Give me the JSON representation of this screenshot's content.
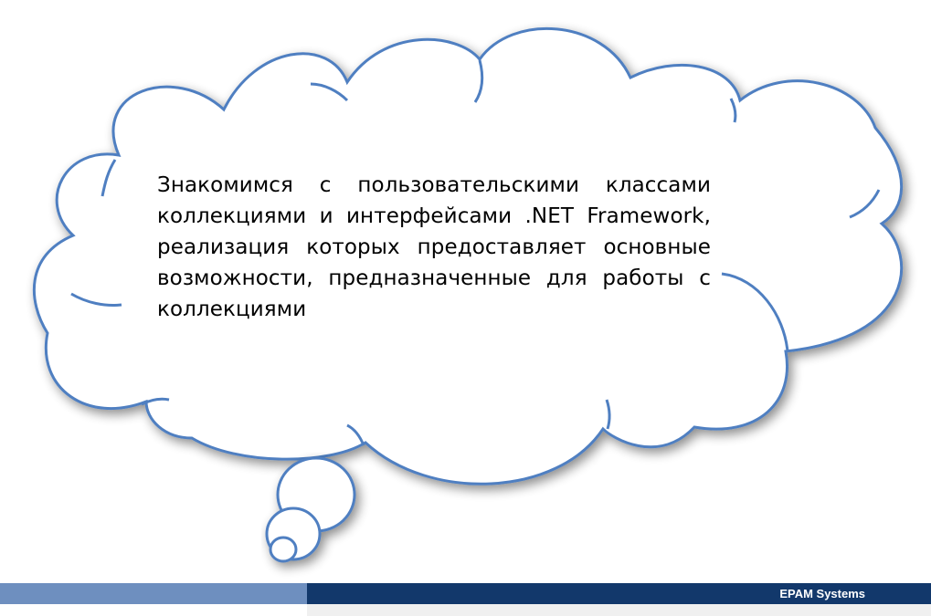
{
  "slide": {
    "bubble_text": "Знакомимся с пользовательскими классами коллекциями и интерфейсами .NET Framework, реализация которых предоставляет основные возможности, предназначенные для работы с коллекциями"
  },
  "footer": {
    "brand": "EPAM Systems"
  },
  "colors": {
    "cloud_outline": "#4f7fc1",
    "footer_light": "#6e8fbf",
    "footer_dark": "#12386b"
  },
  "icons": {
    "cloud": "thought-bubble-icon"
  }
}
